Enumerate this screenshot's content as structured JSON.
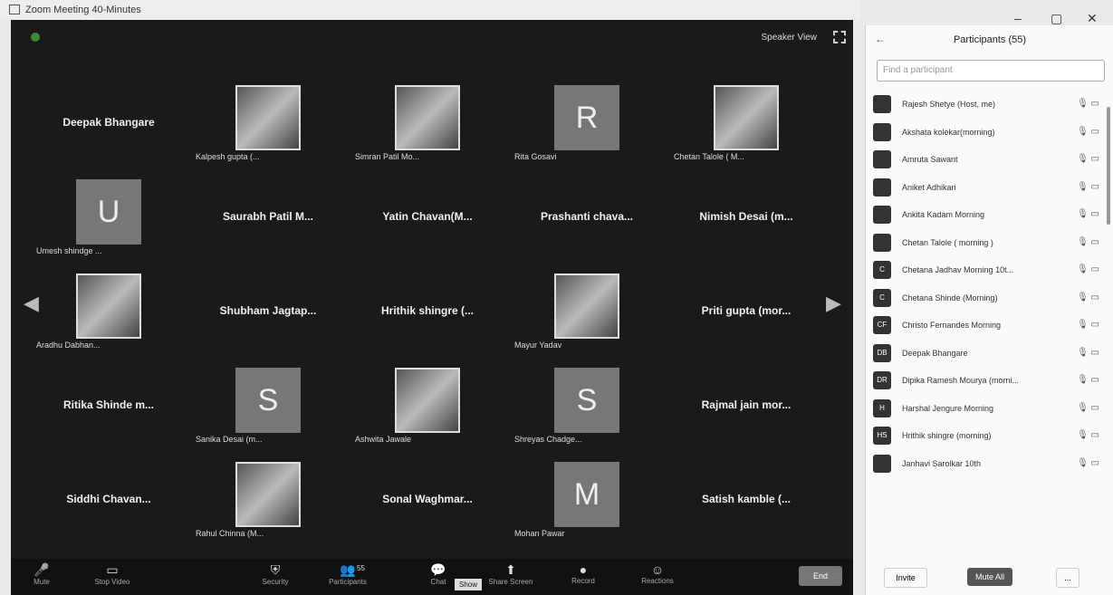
{
  "window": {
    "title": "Zoom Meeting 40-Minutes"
  },
  "topbar": {
    "view_label": "Speaker View"
  },
  "tiles": [
    {
      "name": "Deepak Bhangare",
      "sub": "",
      "type": "name"
    },
    {
      "name": "",
      "sub": "Kalpesh gupta (...",
      "type": "pic"
    },
    {
      "name": "",
      "sub": "Simran Patil Mo...",
      "type": "pic"
    },
    {
      "name": "R",
      "sub": "Rita Gosavi",
      "type": "letter"
    },
    {
      "name": "",
      "sub": "Chetan Talole ( M...",
      "type": "pic"
    },
    {
      "name": "U",
      "sub": "Umesh shindge ...",
      "type": "letter"
    },
    {
      "name": "Saurabh Patil M...",
      "sub": "",
      "type": "name"
    },
    {
      "name": "Yatin Chavan(M...",
      "sub": "",
      "type": "name"
    },
    {
      "name": "Prashanti chava...",
      "sub": "",
      "type": "name"
    },
    {
      "name": "Nimish Desai (m...",
      "sub": "",
      "type": "name"
    },
    {
      "name": "",
      "sub": "Aradhu Dabhan...",
      "type": "pic"
    },
    {
      "name": "Shubham Jagtap...",
      "sub": "",
      "type": "name"
    },
    {
      "name": "Hrithik shingre (...",
      "sub": "",
      "type": "name"
    },
    {
      "name": "",
      "sub": "Mayur Yadav",
      "type": "pic"
    },
    {
      "name": "Priti gupta (mor...",
      "sub": "",
      "type": "name"
    },
    {
      "name": "Ritika Shinde m...",
      "sub": "",
      "type": "name"
    },
    {
      "name": "S",
      "sub": "Sanika Desai (m...",
      "type": "letter"
    },
    {
      "name": "",
      "sub": "Ashwita Jawale",
      "type": "pic"
    },
    {
      "name": "S",
      "sub": "Shreyas Chadge...",
      "type": "letter"
    },
    {
      "name": "Rajmal jain mor...",
      "sub": "",
      "type": "name"
    },
    {
      "name": "Siddhi Chavan...",
      "sub": "",
      "type": "name"
    },
    {
      "name": "",
      "sub": "Rahul Chinna (M...",
      "type": "pic"
    },
    {
      "name": "Sonal Waghmar...",
      "sub": "",
      "type": "name"
    },
    {
      "name": "M",
      "sub": "Mohan Pawar",
      "type": "letter"
    },
    {
      "name": "Satish kamble (...",
      "sub": "",
      "type": "name"
    }
  ],
  "toolbar": {
    "items": [
      {
        "label": "Mute",
        "glyph": "🎤"
      },
      {
        "label": "Stop Video",
        "glyph": "▭"
      },
      {
        "label": "Security",
        "glyph": "⛨"
      },
      {
        "label": "Participants",
        "glyph": "👥"
      },
      {
        "label": "Chat",
        "glyph": "💬"
      },
      {
        "label": "Share Screen",
        "glyph": "⬆"
      },
      {
        "label": "Record",
        "glyph": "●"
      },
      {
        "label": "Reactions",
        "glyph": "☺"
      }
    ],
    "participant_count": "55",
    "tooltip": "Show",
    "end_label": "End"
  },
  "panel": {
    "header": "Participants (55)",
    "search_placeholder": "Find a participant",
    "participants": [
      {
        "name": "Rajesh Shetye (Host, me)",
        "av": ""
      },
      {
        "name": "Akshata kolekar(morning)",
        "av": ""
      },
      {
        "name": "Amruta Sawant",
        "av": ""
      },
      {
        "name": "Aniket Adhikari",
        "av": ""
      },
      {
        "name": "Ankita Kadam Morning",
        "av": ""
      },
      {
        "name": "Chetan Talole ( morning )",
        "av": ""
      },
      {
        "name": "Chetana Jadhav Morning 10t...",
        "av": "C"
      },
      {
        "name": "Chetana Shinde (Morning)",
        "av": "C"
      },
      {
        "name": "Christo Fernandes Morning",
        "av": "CF"
      },
      {
        "name": "Deepak Bhangare",
        "av": "DB"
      },
      {
        "name": "Dipika Ramesh Mourya (morni...",
        "av": "DR"
      },
      {
        "name": "Harshal Jengure Morning",
        "av": "H"
      },
      {
        "name": "Hrithik shingre (morning)",
        "av": "HS"
      },
      {
        "name": "Janhavi Sarolkar 10th",
        "av": ""
      }
    ],
    "invite_label": "Invite",
    "mute_all_label": "Mute All",
    "more_label": "..."
  }
}
